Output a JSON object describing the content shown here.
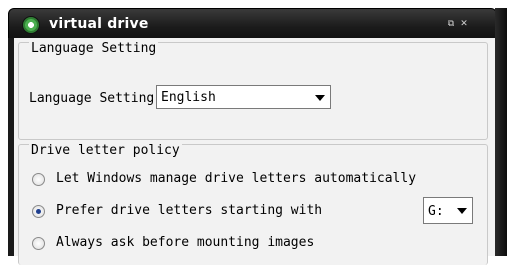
{
  "window": {
    "title": "virtual drive",
    "buttons": [
      "restore",
      "close"
    ]
  },
  "language_group": {
    "title": "Language Setting",
    "label": "Language Setting",
    "selected": "English"
  },
  "drive_group": {
    "title": "Drive letter policy",
    "options": [
      {
        "label": "Let Windows manage drive letters automatically",
        "checked": false
      },
      {
        "label": "Prefer drive letters starting with",
        "checked": true
      },
      {
        "label": "Always ask before mounting images",
        "checked": false
      }
    ],
    "drive_letter": "G:"
  }
}
